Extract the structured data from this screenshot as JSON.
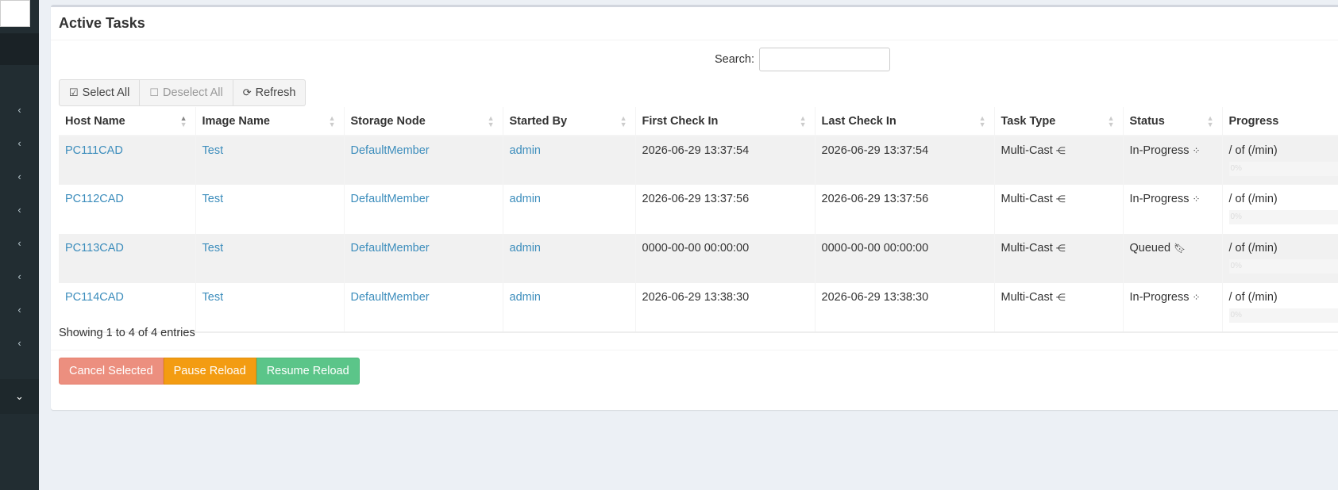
{
  "sidebar": {
    "items": [
      {
        "icon": "chevron-left-icon",
        "glyph": "‹"
      },
      {
        "icon": "chevron-left-icon",
        "glyph": "‹"
      },
      {
        "icon": "chevron-left-icon",
        "glyph": "‹"
      },
      {
        "icon": "chevron-left-icon",
        "glyph": "‹"
      },
      {
        "icon": "chevron-left-icon",
        "glyph": "‹"
      },
      {
        "icon": "chevron-left-icon",
        "glyph": "‹"
      },
      {
        "icon": "chevron-left-icon",
        "glyph": "‹"
      },
      {
        "icon": "chevron-left-icon",
        "glyph": "‹"
      },
      {
        "icon": "chevron-down-icon",
        "glyph": "⌄"
      }
    ]
  },
  "box": {
    "title": "Active Tasks"
  },
  "search": {
    "label": "Search:",
    "value": ""
  },
  "toolbar": {
    "select_all": "Select All",
    "deselect_all": "Deselect All",
    "refresh": "Refresh",
    "select_all_icon": "☑",
    "deselect_all_icon": "☐",
    "refresh_icon": "⟳"
  },
  "table": {
    "columns": [
      "Host Name",
      "Image Name",
      "Storage Node",
      "Started By",
      "First Check In",
      "Last Check In",
      "Task Type",
      "Status",
      "Progress"
    ],
    "rows": [
      {
        "host": "PC111CAD",
        "image": "Test",
        "storage": "DefaultMember",
        "started_by": "admin",
        "first": "2026-06-29 13:37:54",
        "last": "2026-06-29 13:37:54",
        "type": "Multi-Cast",
        "status": "In-Progress",
        "status_icon": "spinner-icon",
        "progress_text": "/ of (/min)",
        "progress_pct": "0%"
      },
      {
        "host": "PC112CAD",
        "image": "Test",
        "storage": "DefaultMember",
        "started_by": "admin",
        "first": "2026-06-29 13:37:56",
        "last": "2026-06-29 13:37:56",
        "type": "Multi-Cast",
        "status": "In-Progress",
        "status_icon": "spinner-icon",
        "progress_text": "/ of (/min)",
        "progress_pct": "0%"
      },
      {
        "host": "PC113CAD",
        "image": "Test",
        "storage": "DefaultMember",
        "started_by": "admin",
        "first": "0000-00-00 00:00:00",
        "last": "0000-00-00 00:00:00",
        "type": "Multi-Cast",
        "status": "Queued",
        "status_icon": "bookmark-icon",
        "progress_text": "/ of (/min)",
        "progress_pct": "0%"
      },
      {
        "host": "PC114CAD",
        "image": "Test",
        "storage": "DefaultMember",
        "started_by": "admin",
        "first": "2026-06-29 13:38:30",
        "last": "2026-06-29 13:38:30",
        "type": "Multi-Cast",
        "status": "In-Progress",
        "status_icon": "spinner-icon",
        "progress_text": "/ of (/min)",
        "progress_pct": "0%"
      }
    ]
  },
  "info": "Showing 1 to 4 of 4 entries",
  "actions": {
    "cancel": "Cancel Selected",
    "pause": "Pause Reload",
    "resume": "Resume Reload"
  },
  "colors": {
    "cancel": "#ec8f7f",
    "pause": "#f39c12",
    "resume": "#5bc589",
    "link": "#3c8dbc",
    "sidebar": "#222d32"
  }
}
